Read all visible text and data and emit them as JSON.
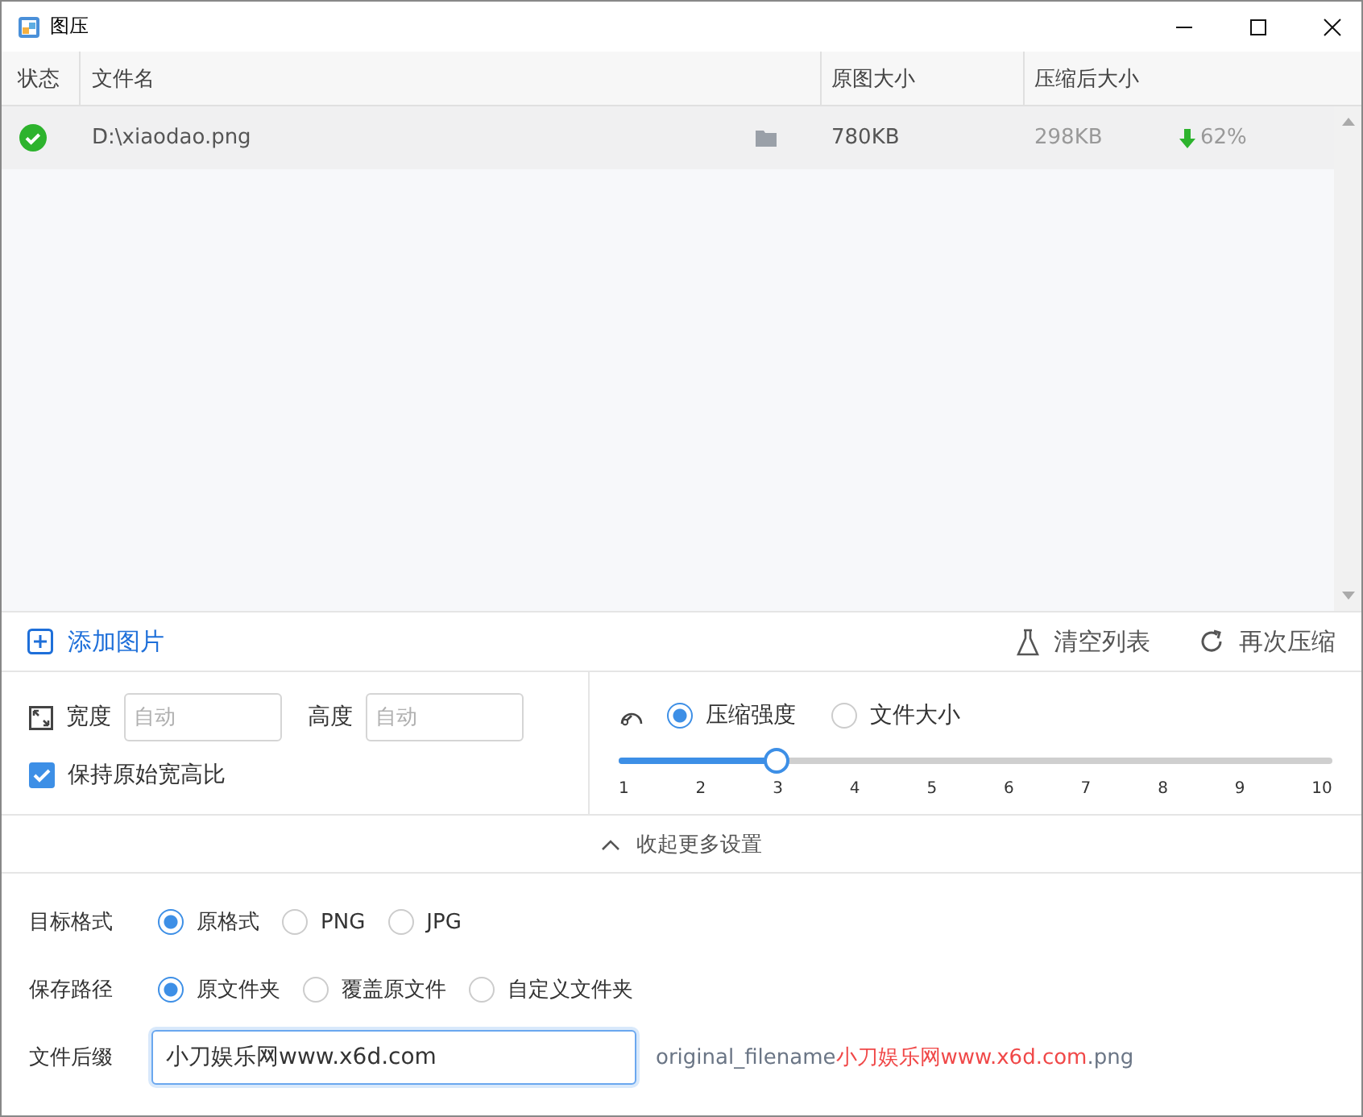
{
  "window": {
    "title": "图压"
  },
  "table": {
    "columns": [
      "状态",
      "文件名",
      "原图大小",
      "压缩后大小"
    ],
    "rows": [
      {
        "success": true,
        "file": "D:\\xiaodao.png",
        "original_size": "780KB",
        "compressed_size": "298KB",
        "reduction": "62%"
      }
    ]
  },
  "toolbar": {
    "add": "添加图片",
    "clear": "清空列表",
    "recompress": "再次压缩"
  },
  "resize": {
    "width_label": "宽度",
    "width_placeholder": "自动",
    "height_label": "高度",
    "height_placeholder": "自动",
    "keep_ratio": {
      "label": "保持原始宽高比",
      "checked": true
    }
  },
  "compression": {
    "modes": [
      {
        "label": "压缩强度",
        "selected": true
      },
      {
        "label": "文件大小",
        "selected": false
      }
    ],
    "slider": {
      "level": 0.2222,
      "ticks": [
        "1",
        "2",
        "3",
        "4",
        "5",
        "6",
        "7",
        "8",
        "9",
        "10"
      ]
    }
  },
  "collapse": "收起更多设置",
  "format": {
    "label": "目标格式",
    "options": [
      {
        "label": "原格式",
        "selected": true
      },
      {
        "label": "PNG",
        "selected": false
      },
      {
        "label": "JPG",
        "selected": false
      }
    ]
  },
  "save_path": {
    "label": "保存路径",
    "options": [
      {
        "label": "原文件夹",
        "selected": true
      },
      {
        "label": "覆盖原文件",
        "selected": false
      },
      {
        "label": "自定义文件夹",
        "selected": false
      }
    ]
  },
  "suffix": {
    "label": "文件后缀",
    "value": "小刀娱乐网www.x6d.com",
    "preview_base": "original_filename",
    "preview_suffix": "小刀娱乐网www.x6d.com",
    "preview_ext": ".png"
  }
}
